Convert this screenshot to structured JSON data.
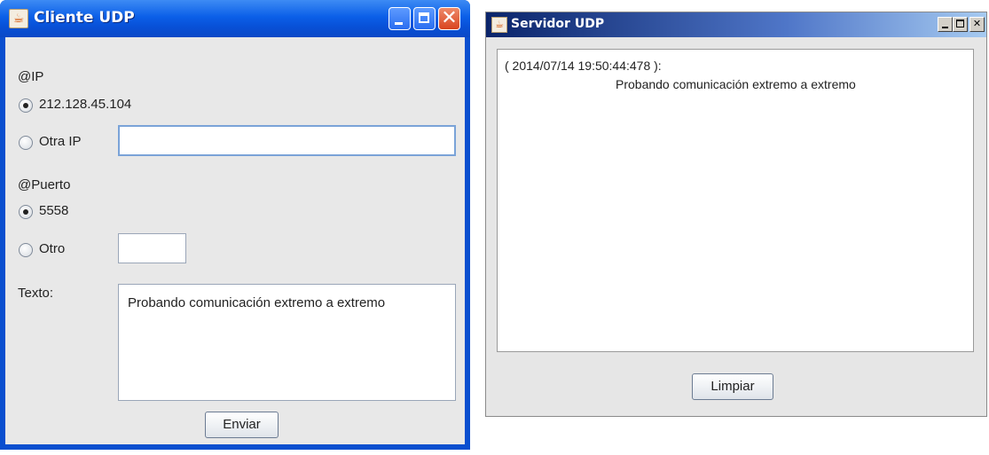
{
  "client": {
    "title": "Cliente UDP",
    "ip_label": "@IP",
    "ip_option_default": "212.128.45.104",
    "ip_option_other": "Otra IP",
    "other_ip_value": "",
    "port_label": "@Puerto",
    "port_option_default": "5558",
    "port_option_other": "Otro",
    "other_port_value": "",
    "text_label": "Texto:",
    "message": "Probando comunicación extremo a extremo",
    "send_button": "Enviar",
    "selected_ip_option": "default",
    "selected_port_option": "default"
  },
  "server": {
    "title": "Servidor UDP",
    "log_timestamp": "( 2014/07/14 19:50:44:478 ):",
    "log_message": "Probando comunicación extremo a extremo",
    "clear_button": "Limpiar"
  },
  "icons": {
    "java": "java-cup-icon",
    "minimize": "minimize-icon",
    "maximize": "maximize-icon",
    "close": "close-icon"
  },
  "colors": {
    "xp_titlebar": "#0b5fe8",
    "xp_frame": "#0a4fcf",
    "xp_close": "#d9441f",
    "classic_titlebar_start": "#0a246a",
    "classic_titlebar_end": "#a6caf0",
    "panel_bg": "#e8e8e8"
  }
}
